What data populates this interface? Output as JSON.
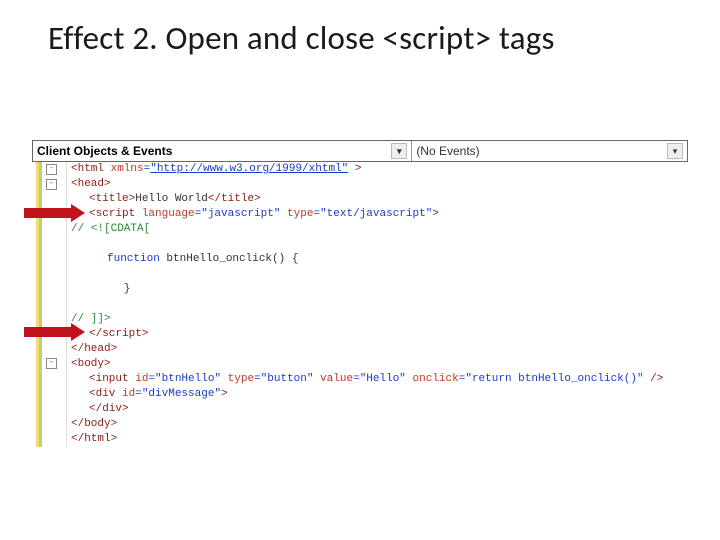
{
  "title": "Effect 2. Open and close <script> tags",
  "combos": {
    "left_label": "Client Objects & Events",
    "right_label": "(No Events)"
  },
  "code": {
    "l1_a": "<html ",
    "l1_b": "xmlns",
    "l1_c": "=",
    "l1_d": "\"http://www.w3.org/1999/xhtml\"",
    "l1_e": " >",
    "l2": "<head>",
    "l3_a": "<title>",
    "l3_b": "Hello World",
    "l3_c": "</title>",
    "l4_a": "<script ",
    "l4_b": "language",
    "l4_c": "=",
    "l4_d": "\"javascript\"",
    "l4_e": " type",
    "l4_f": "=",
    "l4_g": "\"text/javascript\"",
    "l4_h": ">",
    "l5": "// <![CDATA[",
    "l6": "",
    "l7_a": "function",
    "l7_b": " btnHello_onclick() {",
    "l8": "",
    "l9": "        }",
    "l10": "",
    "l11": "// ]]>",
    "l12": "</script>",
    "l13": "</head>",
    "l14": "<body>",
    "l15_a": "<input ",
    "l15_b": "id",
    "l15_c": "=",
    "l15_d": "\"btnHello\"",
    "l15_e": " type",
    "l15_f": "=",
    "l15_g": "\"button\"",
    "l15_h": " value",
    "l15_i": "=",
    "l15_j": "\"Hello\"",
    "l15_k": " onclick",
    "l15_l": "=",
    "l15_m": "\"return btnHello_onclick()\"",
    "l15_n": " />",
    "l16_a": "<div ",
    "l16_b": "id",
    "l16_c": "=",
    "l16_d": "\"divMessage\"",
    "l16_e": ">",
    "l17": "</div>",
    "l18": "</body>",
    "l19": "</html>"
  }
}
